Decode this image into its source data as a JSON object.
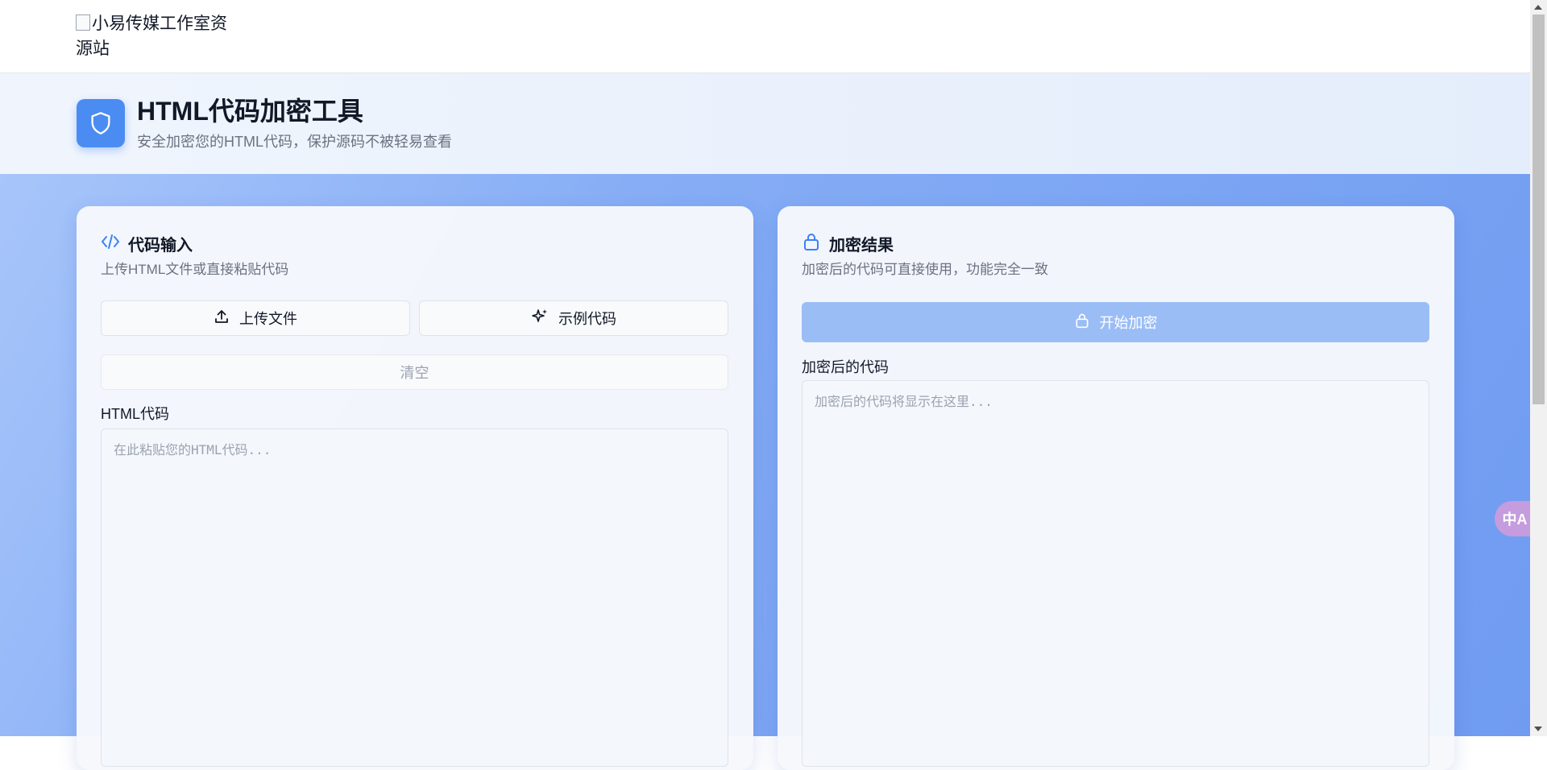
{
  "site": {
    "logo_alt": "小易传媒工作室资源站"
  },
  "hero": {
    "title": "HTML代码加密工具",
    "subtitle": "安全加密您的HTML代码，保护源码不被轻易查看",
    "icon": "shield-icon"
  },
  "input_panel": {
    "title": "代码输入",
    "subtitle": "上传HTML文件或直接粘贴代码",
    "upload_label": "上传文件",
    "example_label": "示例代码",
    "clear_label": "清空",
    "field_label": "HTML代码",
    "placeholder": "在此粘贴您的HTML代码..."
  },
  "output_panel": {
    "title": "加密结果",
    "subtitle": "加密后的代码可直接使用，功能完全一致",
    "encrypt_label": "开始加密",
    "field_label": "加密后的代码",
    "placeholder": "加密后的代码将显示在这里..."
  },
  "translate_fab": {
    "label": "中A"
  },
  "colors": {
    "accent": "#4b8cf2",
    "encrypt_disabled": "#9bbdf6",
    "translate": "#c59cde"
  }
}
